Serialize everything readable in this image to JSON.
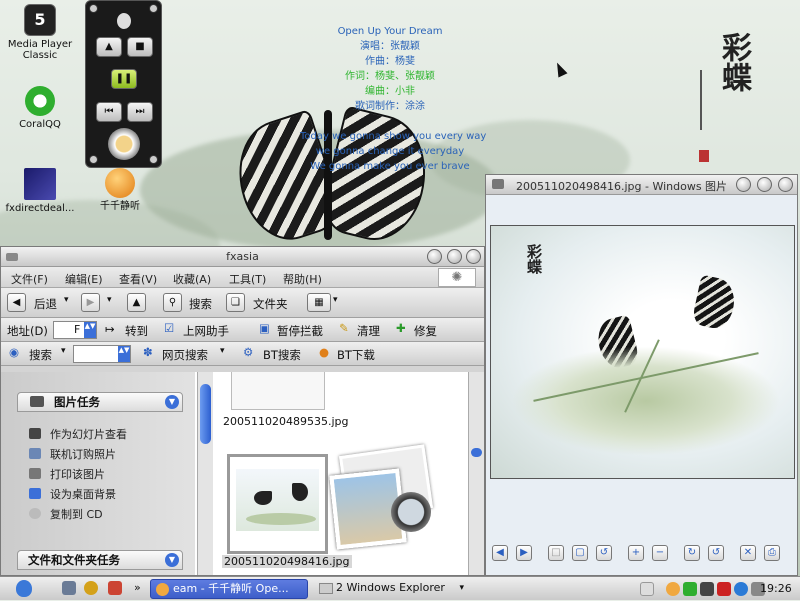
{
  "desktop": {
    "icons": [
      {
        "label_lines": [
          "Media Player",
          "Classic"
        ],
        "icon": "media-player-classic-icon"
      },
      {
        "label_lines": [
          "CoralQQ"
        ],
        "icon": "coralqq-icon"
      },
      {
        "label_lines": [
          "fxdirectdeal..."
        ],
        "icon": "fxdirectdeal-icon"
      },
      {
        "label_lines": [
          "千千静听"
        ],
        "icon": "ttplayer-icon"
      }
    ],
    "lyrics": [
      {
        "text": "Open Up Your Dream",
        "color": "#2a63b8"
      },
      {
        "text": "演唱：张靓颖",
        "color": "#2a63b8"
      },
      {
        "text": "作曲：杨斐",
        "color": "#2a63b8"
      },
      {
        "text": "作词：杨斐、张靓颖",
        "color": "#2fb52f"
      },
      {
        "text": "编曲：小非",
        "color": "#2fb52f"
      },
      {
        "text": "歌词制作：涂涂",
        "color": "#2a63b8"
      },
      {
        "text": "",
        "color": "#2a63b8"
      },
      {
        "text": "Today we gonna show you every way",
        "color": "#2a63b8"
      },
      {
        "text": "we gonna change it everyday",
        "color": "#2a63b8"
      },
      {
        "text": "We gonna make you ever brave",
        "color": "#2a63b8"
      }
    ],
    "calligraphy": "彩蝶"
  },
  "explorer": {
    "title": "fxasia",
    "menu": [
      "文件(F)",
      "编辑(E)",
      "查看(V)",
      "收藏(A)",
      "工具(T)",
      "帮助(H)"
    ],
    "toolbar": {
      "back": "后退",
      "search": "搜索",
      "folders": "文件夹"
    },
    "address": {
      "label": "地址(D)",
      "value": "F",
      "go": "转到"
    },
    "links": {
      "helper": "上网助手",
      "popup_block": "暂停拦截",
      "clean": "清理",
      "repair": "修复"
    },
    "search_bar": {
      "search": "搜索",
      "web_search": "网页搜索",
      "bt_search": "BT搜索",
      "bt_download": "BT下载"
    },
    "picture_tasks": {
      "header": "图片任务",
      "items": [
        "作为幻灯片查看",
        "联机订购照片",
        "打印该图片",
        "设为桌面背景",
        "复制到 CD"
      ]
    },
    "file_tasks_header": "文件和文件夹任务",
    "files": [
      "200511020489535.jpg",
      "200511020498416.jpg"
    ]
  },
  "viewer": {
    "title": "200511020498416.jpg - Windows 图片..."
  },
  "taskbar": {
    "buttons": [
      {
        "label": "eam - 千千静听  Ope...",
        "active": true
      },
      {
        "label": "2 Windows Explorer",
        "active": false
      }
    ],
    "clock": "19:26"
  }
}
